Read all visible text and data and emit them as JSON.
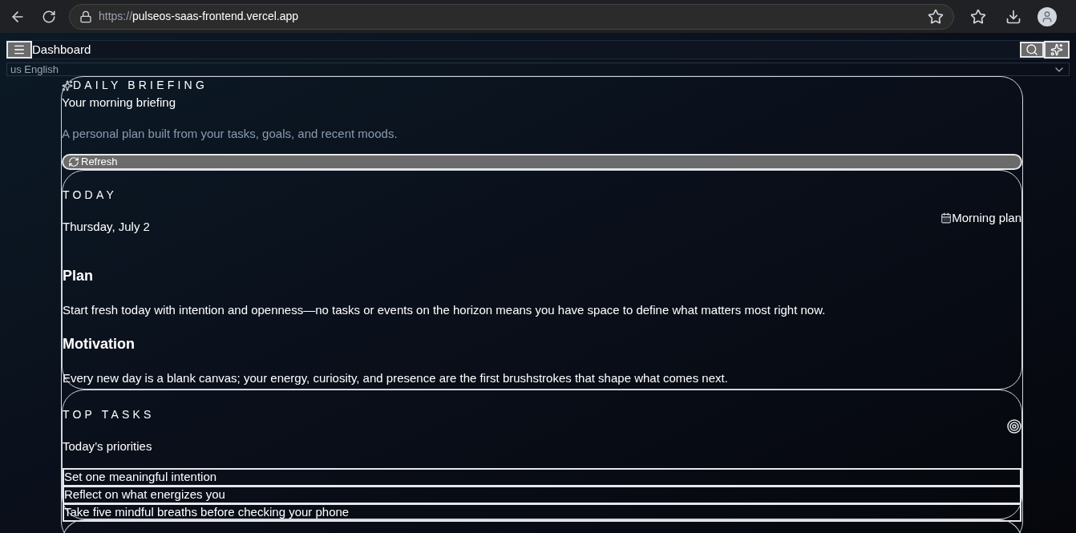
{
  "browser": {
    "url_scheme": "https://",
    "url_host": "pulseos-saas-frontend.vercel.app"
  },
  "header": {
    "title": "Dashboard"
  },
  "language": {
    "value": "us English"
  },
  "briefing": {
    "eyebrow": "DAILY BRIEFING",
    "title": "Your morning briefing",
    "subtitle": "A personal plan built from your tasks, goals, and recent moods.",
    "refresh_button": "Refresh"
  },
  "today": {
    "eyebrow": "TODAY",
    "date": "Thursday, July 2",
    "badge": "Morning plan",
    "sections": [
      {
        "heading": "Plan",
        "text": "Start fresh today with intention and openness—no tasks or events on the horizon means you have space to define what matters most right now."
      },
      {
        "heading": "Motivation",
        "text": "Every new day is a blank canvas; your energy, curiosity, and presence are the first brushstrokes that shape what comes next."
      }
    ]
  },
  "top_tasks": {
    "eyebrow": "TOP TASKS",
    "title": "Today’s priorities",
    "tasks": [
      "Set one meaningful intention",
      "Reflect on what energizes you",
      "Take five mindful breaths before checking your phone"
    ]
  }
}
